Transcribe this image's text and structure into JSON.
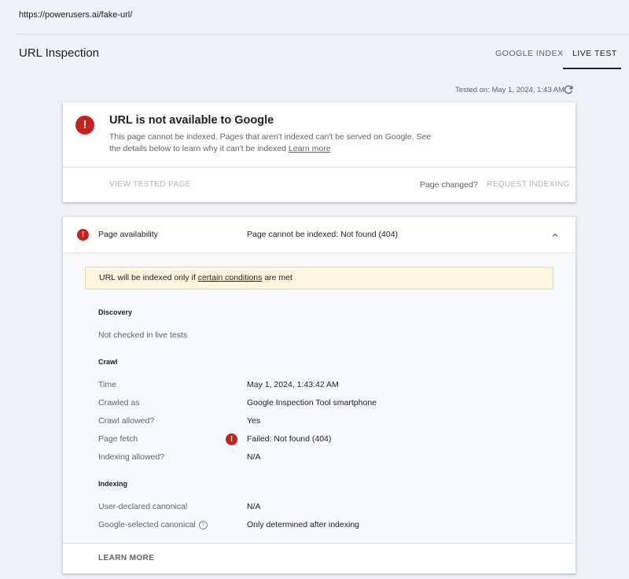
{
  "url": "https://powerusers.ai/fake-url/",
  "header": {
    "title": "URL Inspection",
    "tabs": [
      {
        "label": "GOOGLE INDEX"
      },
      {
        "label": "LIVE TEST"
      }
    ],
    "active_tab": "LIVE TEST"
  },
  "tested_on": "Tested on: May 1, 2024, 1:43 AM",
  "status": {
    "icon": "error-icon",
    "title": "URL is not available to Google",
    "desc_line1": "This page cannot be indexed. Pages that aren't indexed can't be served on Google. See",
    "desc_line2": "the details below to learn why it can't be indexed",
    "learn_more_link": "Learn more",
    "view_tested_page": "VIEW TESTED PAGE",
    "page_changed": "Page changed?",
    "request_indexing": "REQUEST INDEXING"
  },
  "availability": {
    "label": "Page availability",
    "value": "Page cannot be indexed: Not found (404)",
    "warning_pre": "URL will be indexed only if",
    "warning_link": "certain conditions",
    "warning_post": "are met",
    "discovery": {
      "heading": "Discovery",
      "text": "Not checked in live tests"
    },
    "crawl": {
      "heading": "Crawl",
      "rows": [
        {
          "label": "Time",
          "value": "May 1, 2024, 1:43:42 AM"
        },
        {
          "label": "Crawled as",
          "value": "Google Inspection Tool smartphone"
        },
        {
          "label": "Crawl allowed?",
          "value": "Yes"
        },
        {
          "label": "Page fetch",
          "value": "Failed: Not found (404)"
        },
        {
          "label": "Indexing allowed?",
          "value": "N/A"
        }
      ]
    },
    "indexing": {
      "heading": "Indexing",
      "rows": [
        {
          "label": "User-declared canonical",
          "value": "N/A"
        },
        {
          "label": "Google-selected canonical",
          "value": "Only determined after indexing"
        }
      ]
    },
    "learn_more": "LEARN MORE"
  },
  "colors": {
    "error": "#c5221f",
    "warning_bg": "#fef7e0",
    "background": "#eef1f6"
  }
}
